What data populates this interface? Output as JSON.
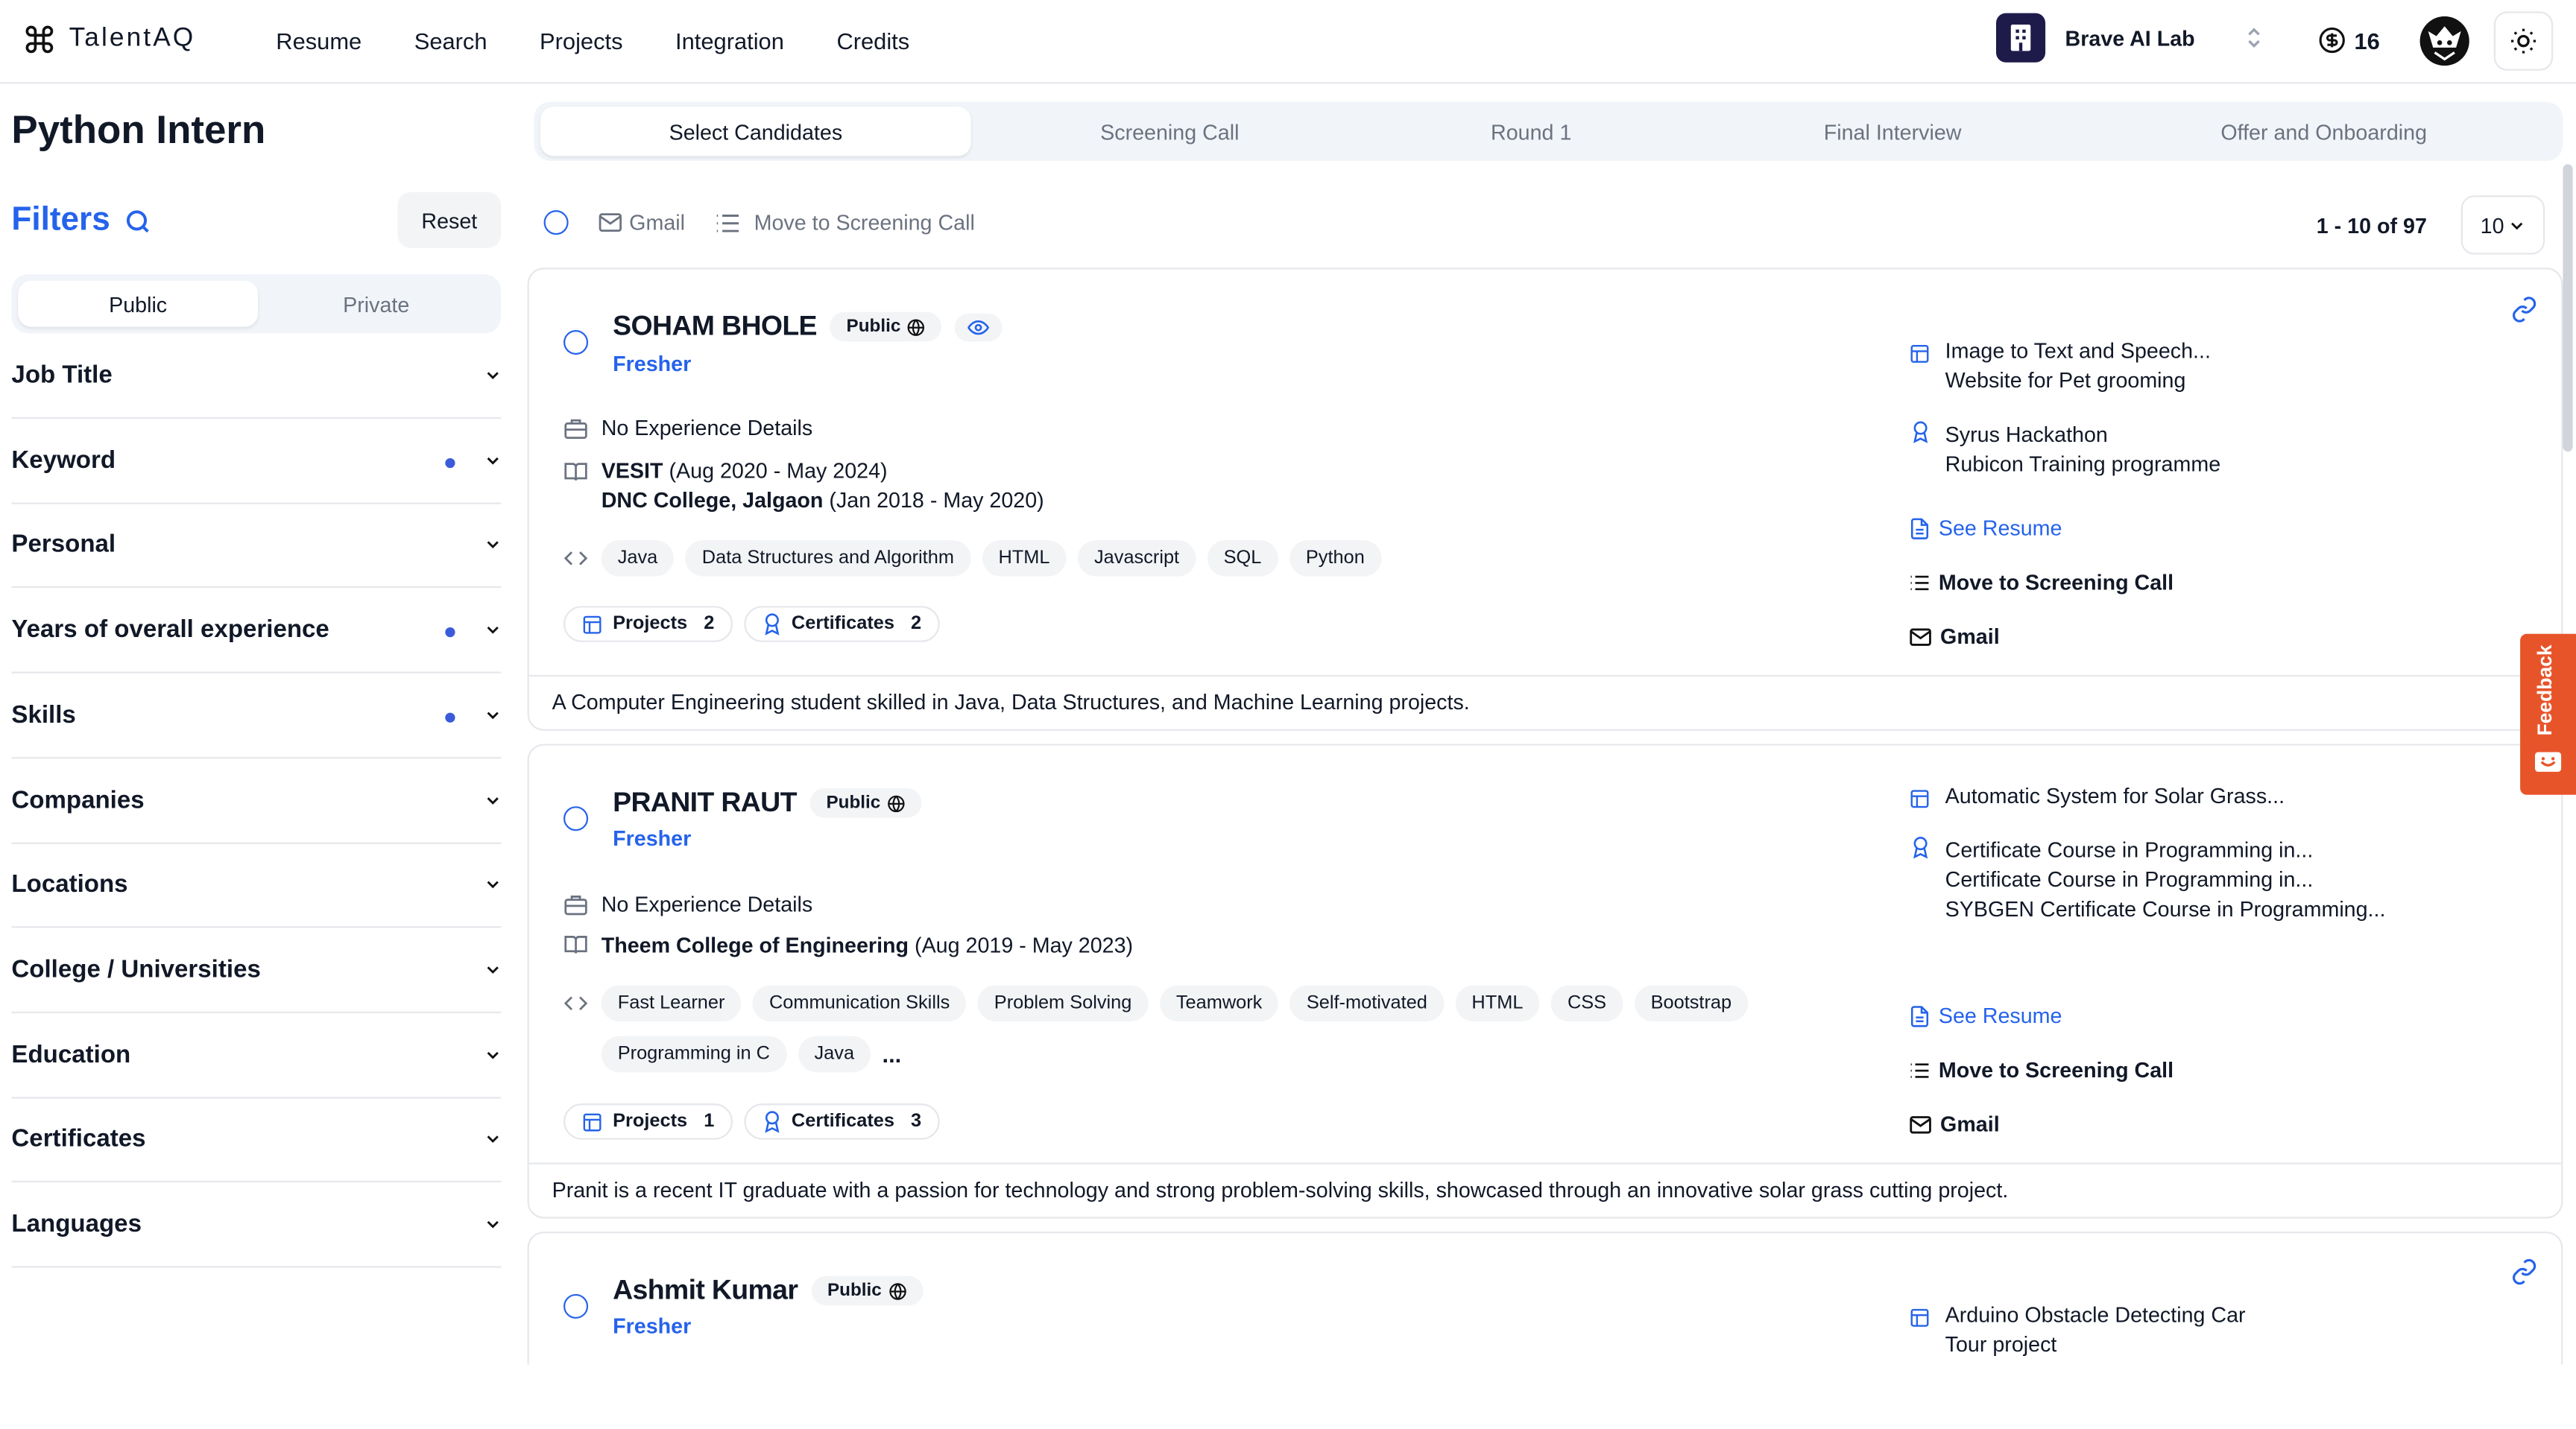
{
  "header": {
    "logo": "TalentAQ",
    "nav": [
      "Resume",
      "Search",
      "Projects",
      "Integration",
      "Credits"
    ],
    "org_name": "Brave AI Lab",
    "credits": "16"
  },
  "page": {
    "title": "Python Intern"
  },
  "filters": {
    "title": "Filters",
    "reset": "Reset",
    "public": "Public",
    "private": "Private",
    "items": [
      {
        "label": "Job Title",
        "active": false
      },
      {
        "label": "Keyword",
        "active": true
      },
      {
        "label": "Personal",
        "active": false
      },
      {
        "label": "Years of overall experience",
        "active": true
      },
      {
        "label": "Skills",
        "active": true
      },
      {
        "label": "Companies",
        "active": false
      },
      {
        "label": "Locations",
        "active": false
      },
      {
        "label": "College / Universities",
        "active": false
      },
      {
        "label": "Education",
        "active": false
      },
      {
        "label": "Certificates",
        "active": false
      },
      {
        "label": "Languages",
        "active": false
      }
    ]
  },
  "stages": [
    "Select Candidates",
    "Screening Call",
    "Round 1",
    "Final Interview",
    "Offer and Onboarding"
  ],
  "toolbar": {
    "gmail": "Gmail",
    "move": "Move to Screening Call",
    "range": "1 - 10 of 97",
    "page_size": "10"
  },
  "candidates": [
    {
      "name": "SOHAM BHOLE",
      "visibility": "Public",
      "level": "Fresher",
      "experience": "No Experience Details",
      "edu1_school": "VESIT",
      "edu1_dates": "(Aug 2020 - May 2024)",
      "edu2_school": "DNC College, Jalgaon",
      "edu2_dates": "(Jan 2018 - May 2020)",
      "skills": [
        "Java",
        "Data Structures and Algorithm",
        "HTML",
        "Javascript",
        "SQL",
        "Python"
      ],
      "projects_label": "Projects",
      "projects_count": "2",
      "certs_label": "Certificates",
      "certs_count": "2",
      "project_titles": [
        "Image to Text and Speech...",
        "Website for Pet grooming"
      ],
      "cert_titles": [
        "Syrus Hackathon",
        "Rubicon Training programme"
      ],
      "see_resume": "See Resume",
      "move": "Move to Screening Call",
      "gmail": "Gmail",
      "summary": "A Computer Engineering student skilled in Java, Data Structures, and Machine Learning projects."
    },
    {
      "name": "PRANIT RAUT",
      "visibility": "Public",
      "level": "Fresher",
      "experience": "No Experience Details",
      "edu1_school": "Theem College of Engineering",
      "edu1_dates": "(Aug 2019 - May 2023)",
      "skills": [
        "Fast Learner",
        "Communication Skills",
        "Problem Solving",
        "Teamwork",
        "Self-motivated",
        "HTML",
        "CSS",
        "Bootstrap"
      ],
      "skills2": [
        "Programming in C",
        "Java"
      ],
      "more": "...",
      "projects_label": "Projects",
      "projects_count": "1",
      "certs_label": "Certificates",
      "certs_count": "3",
      "project_titles": [
        "Automatic System for Solar Grass..."
      ],
      "cert_titles": [
        "Certificate Course in Programming in...",
        "Certificate Course in Programming in...",
        "SYBGEN Certificate Course in Programming..."
      ],
      "see_resume": "See Resume",
      "move": "Move to Screening Call",
      "gmail": "Gmail",
      "summary": "Pranit is a recent IT graduate with a passion for technology and strong problem-solving skills, showcased through an innovative solar grass cutting project."
    },
    {
      "name": "Ashmit Kumar",
      "visibility": "Public",
      "level": "Fresher",
      "project_titles": [
        "Arduino Obstacle Detecting Car",
        "Tour project"
      ]
    }
  ],
  "feedback": "Feedback",
  "colors": {
    "accent": "#2563eb",
    "feedback": "#e8542a"
  }
}
